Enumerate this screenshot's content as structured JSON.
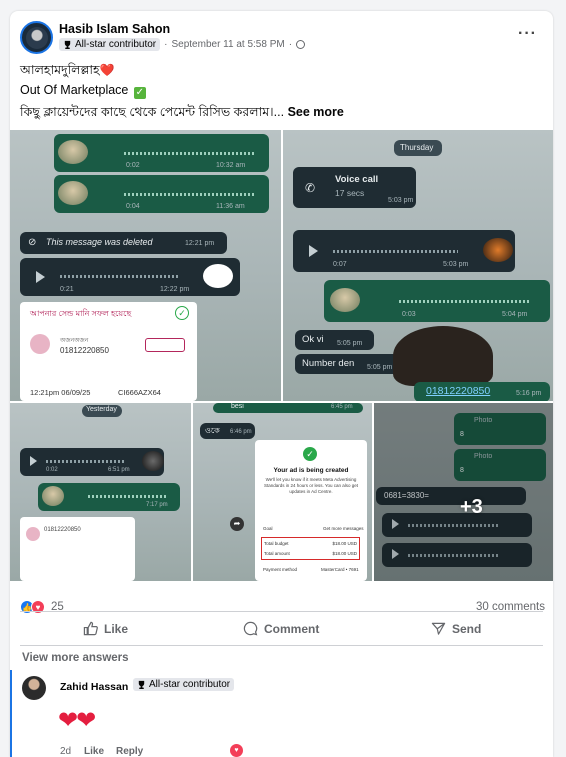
{
  "post": {
    "author": "Hasib Islam Sahon",
    "badge": "All-star contributor",
    "timestamp": "September 11 at 5:58 PM",
    "separator": "·",
    "more": "···",
    "line1": "আলহামদুলিল্লাহ",
    "line1_emoji": "❤️",
    "line2": "Out Of Marketplace",
    "line2_emoji": "✓",
    "line3": "কিছু ক্লায়েন্টদের কাছে থেকে পেমেন্ট রিসিভ করলাম।...",
    "see_more": "See more"
  },
  "images": {
    "img1": {
      "times": [
        "0:02",
        "10:32 am",
        "0:04",
        "11:36 am",
        "12:21 pm",
        "0:21",
        "12:22 pm"
      ],
      "deleted": "This message was deleted",
      "payment_title": "আপনার সেন্ড মানি সফল হয়েছে",
      "contact": "অজনঅজন",
      "number": "01812220850",
      "date": "12:21pm 06/09/25",
      "trxid": "CI666AZX64"
    },
    "img2": {
      "day": "Thursday",
      "voice_call": "Voice call",
      "duration": "17 secs",
      "call_time": "5:03 pm",
      "times": [
        "0:07",
        "5:03 pm",
        "0:03",
        "5:04 pm"
      ],
      "msg1": "Ok vi",
      "msg1_time": "5:05 pm",
      "msg2": "Number den",
      "msg2_time": "5:05 pm",
      "phone": "01812220850",
      "phone_time": "5:16 pm"
    },
    "img3": {
      "day": "Yesterday",
      "times": [
        "0:02",
        "6:51 pm",
        "7:17 pm"
      ],
      "number": "01812220850"
    },
    "img4": {
      "top": "besi",
      "top_time": "6:45 pm",
      "reply": "ওকে",
      "reply_time": "6:46 pm",
      "title": "Your ad is being created",
      "desc": "We'll let you know if it meets Meta Advertising Standards in 24 hours or less. You can also get updates in Ad Centre.",
      "goal": "Goal",
      "goal_val": "Get more messages",
      "budget": "Total budget",
      "budget_val": "$18.00 USD",
      "amount": "Total amount",
      "amount_val": "$18.00 USD",
      "payment": "Payment method",
      "payment_val": "MasterCard • 7691"
    },
    "img5": {
      "photo": "Photo",
      "count1": "8",
      "count2": "8",
      "code": "0681=3830=",
      "more_count": "+3"
    }
  },
  "stats": {
    "reactions_count": "25",
    "comments": "30 comments"
  },
  "actions": {
    "like": "Like",
    "comment": "Comment",
    "send": "Send"
  },
  "view_more": "View more answers",
  "comment": {
    "name": "Zahid Hassan",
    "badge": "All-star contributor",
    "hearts": "❤❤",
    "time": "2d",
    "like": "Like",
    "reply": "Reply"
  },
  "colors": {
    "brand": "#1877f2",
    "love": "#f33e58",
    "whatsapp_green": "#1a5b45",
    "whatsapp_dark": "#1f2c33"
  }
}
